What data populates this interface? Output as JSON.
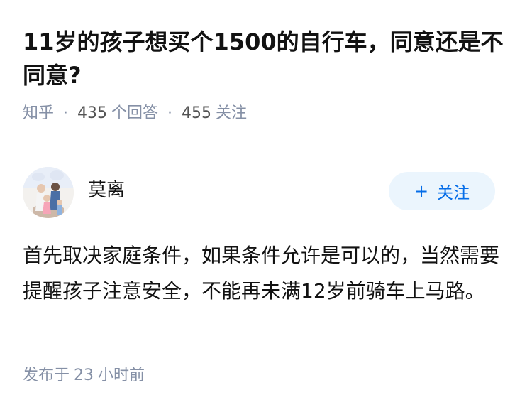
{
  "question": {
    "title": "11岁的孩子想买个1500的自行车，同意还是不同意?",
    "source": "知乎",
    "separator": "·",
    "answers_count": "435",
    "answers_label": "个回答",
    "followers_count": "455",
    "followers_label": "关注"
  },
  "answer": {
    "author_name": "莫离",
    "follow_plus": "+",
    "follow_label": "关注",
    "content": "首先取决家庭条件，如果条件允许是可以的，当然需要提醒孩子注意安全，不能再未满12岁前骑车上马路。",
    "time_prefix": "发布于",
    "time_value": "23",
    "time_suffix": "小时前"
  },
  "colors": {
    "accent": "#056de8",
    "accent_bg": "#ebf5fd",
    "meta_gray": "#8590a6",
    "text": "#121212"
  }
}
